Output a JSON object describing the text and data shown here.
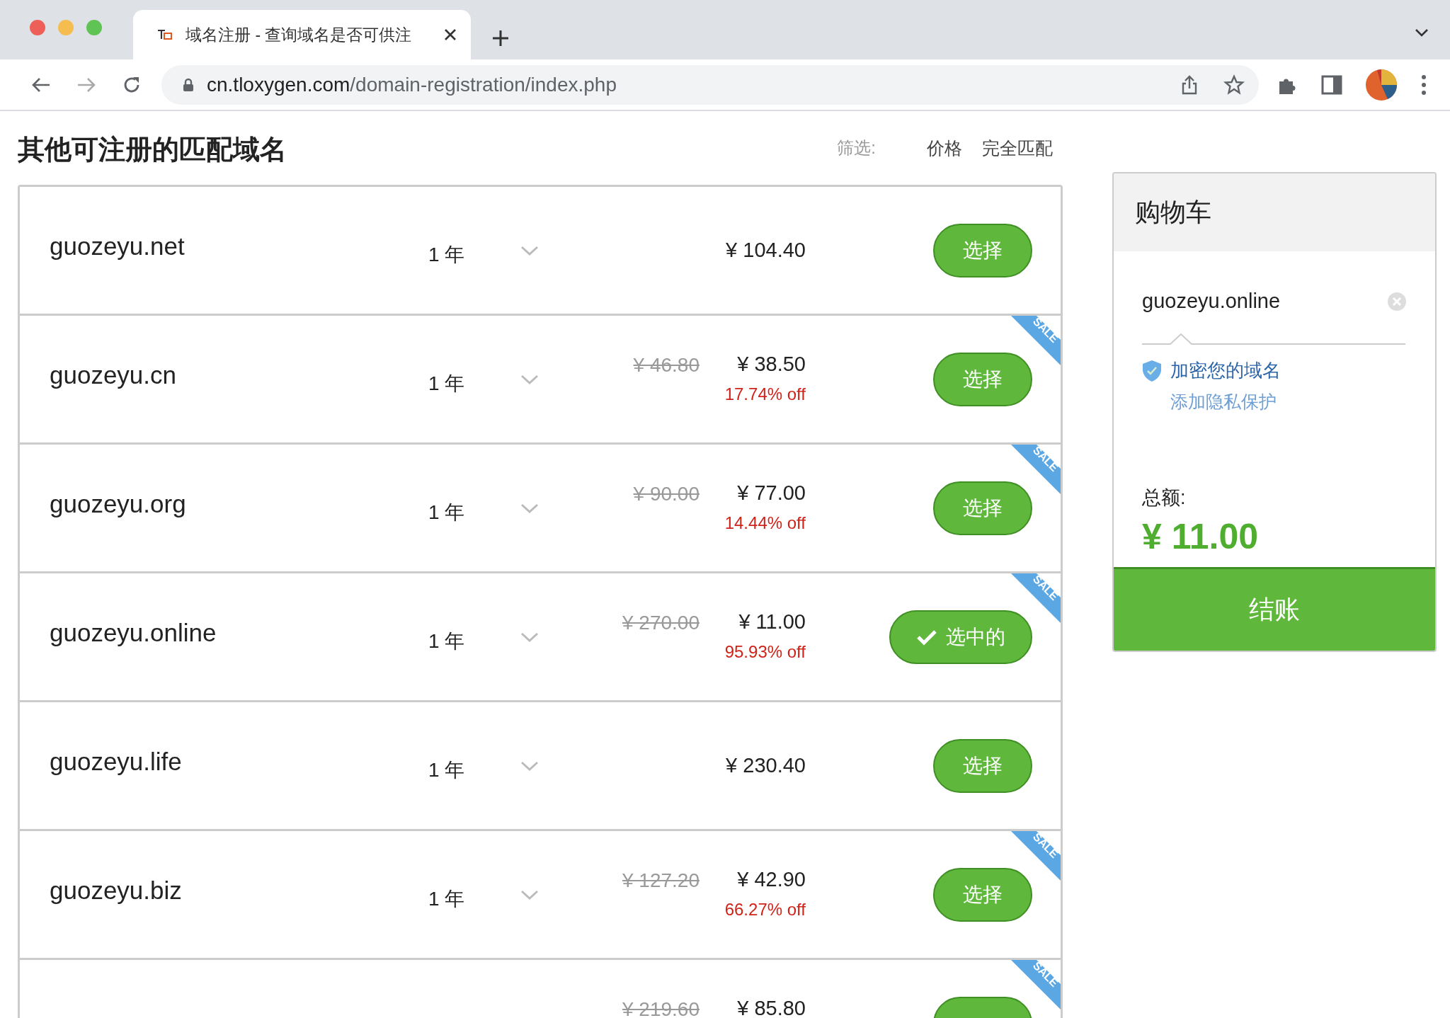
{
  "browser": {
    "tab": {
      "title": "域名注册 - 查询域名是否可供注"
    },
    "url": {
      "host": "cn.tloxygen.com",
      "path": "/domain-registration/index.php"
    }
  },
  "heading": "其他可注册的匹配域名",
  "filter": {
    "label": "筛选:",
    "options": [
      "价格",
      "完全匹配"
    ]
  },
  "rows": [
    {
      "domain": "guozeyu.net",
      "term": "1 年",
      "price": "¥ 104.40",
      "button": "选择",
      "selected": false
    },
    {
      "domain": "guozeyu.cn",
      "term": "1 年",
      "old_price": "¥ 46.80",
      "price": "¥ 38.50",
      "discount": "17.74% off",
      "ribbon": "SALE",
      "button": "选择",
      "selected": false
    },
    {
      "domain": "guozeyu.org",
      "term": "1 年",
      "old_price": "¥ 90.00",
      "price": "¥ 77.00",
      "discount": "14.44% off",
      "ribbon": "SALE",
      "button": "选择",
      "selected": false
    },
    {
      "domain": "guozeyu.online",
      "term": "1 年",
      "old_price": "¥ 270.00",
      "price": "¥ 11.00",
      "discount": "95.93% off",
      "ribbon": "SALE",
      "button": "选中的",
      "selected": true
    },
    {
      "domain": "guozeyu.life",
      "term": "1 年",
      "price": "¥ 230.40",
      "button": "选择",
      "selected": false
    },
    {
      "domain": "guozeyu.biz",
      "term": "1 年",
      "old_price": "¥ 127.20",
      "price": "¥ 42.90",
      "discount": "66.27% off",
      "ribbon": "SALE",
      "button": "选择",
      "selected": false
    },
    {
      "old_price": "¥ 219.60",
      "price": "¥ 85.80",
      "ribbon": "SALE",
      "selected": false
    }
  ],
  "cart": {
    "title": "购物车",
    "item": "guozeyu.online",
    "privacy_title": "加密您的域名",
    "privacy_link": "添加隐私保护",
    "total_label": "总额:",
    "total": "¥ 11.00",
    "checkout": "结账"
  }
}
